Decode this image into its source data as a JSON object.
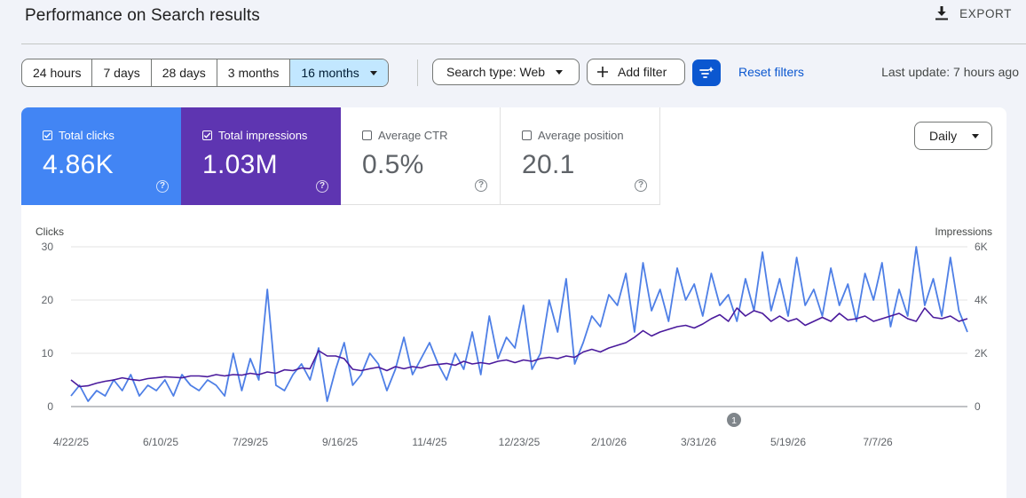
{
  "header": {
    "title": "Performance on Search results",
    "export_label": "EXPORT"
  },
  "filters": {
    "date_ranges": [
      "24 hours",
      "7 days",
      "28 days",
      "3 months",
      "16 months"
    ],
    "selected_range": "16 months",
    "search_type": "Search type: Web",
    "add_filter": "Add filter",
    "reset": "Reset filters",
    "last_update": "Last update: 7 hours ago"
  },
  "metrics": [
    {
      "label": "Total clicks",
      "value": "4.86K",
      "checked": true,
      "color": "#4285f4"
    },
    {
      "label": "Total impressions",
      "value": "1.03M",
      "checked": true,
      "color": "#5e35b1"
    },
    {
      "label": "Average CTR",
      "value": "0.5%",
      "checked": false
    },
    {
      "label": "Average position",
      "value": "20.1",
      "checked": false
    }
  ],
  "granularity": "Daily",
  "chart_data": {
    "type": "line",
    "x_tick_labels": [
      "4/22/25",
      "6/10/25",
      "7/29/25",
      "9/16/25",
      "11/4/25",
      "12/23/25",
      "2/10/26",
      "3/31/26",
      "5/19/26",
      "7/7/26"
    ],
    "y_left": {
      "label": "Clicks",
      "ticks": [
        0,
        10,
        20,
        30
      ],
      "range": [
        0,
        30
      ]
    },
    "y_right": {
      "label": "Impressions",
      "ticks": [
        "0",
        "2K",
        "4K",
        "6K"
      ],
      "range": [
        0,
        6000
      ]
    },
    "annotation": "1",
    "grid": true,
    "series": [
      {
        "name": "Clicks",
        "axis": "left",
        "color": "#4e7fe6",
        "sample_every_days": 4,
        "values": [
          2,
          4,
          1,
          3,
          2,
          5,
          3,
          6,
          2,
          4,
          3,
          5,
          2,
          6,
          4,
          3,
          5,
          4,
          2,
          10,
          3,
          9,
          5,
          22,
          4,
          3,
          6,
          8,
          5,
          11,
          1,
          7,
          12,
          4,
          6,
          10,
          8,
          3,
          7,
          13,
          6,
          9,
          12,
          8,
          5,
          10,
          7,
          14,
          6,
          17,
          9,
          13,
          11,
          19,
          7,
          10,
          20,
          14,
          24,
          8,
          12,
          17,
          15,
          21,
          19,
          25,
          14,
          27,
          18,
          22,
          16,
          26,
          20,
          23,
          17,
          25,
          19,
          21,
          16,
          24,
          18,
          29,
          18,
          24,
          17,
          28,
          19,
          22,
          17,
          26,
          19,
          23,
          16,
          25,
          20,
          27,
          15,
          22,
          17,
          30,
          19,
          24,
          17,
          28,
          18,
          14
        ]
      },
      {
        "name": "Impressions",
        "axis": "right",
        "color": "#4a1a9c",
        "sample_every_days": 4,
        "values": [
          1000,
          750,
          780,
          880,
          950,
          1000,
          1080,
          1020,
          980,
          1050,
          1080,
          1120,
          1100,
          1080,
          1150,
          1150,
          1120,
          1200,
          1150,
          1200,
          1180,
          1250,
          1200,
          1300,
          1250,
          1380,
          1350,
          1450,
          1420,
          2100,
          1900,
          1900,
          1800,
          1400,
          1350,
          1420,
          1480,
          1350,
          1500,
          1420,
          1500,
          1450,
          1550,
          1580,
          1620,
          1550,
          1700,
          1600,
          1650,
          1600,
          1700,
          1750,
          1650,
          1750,
          1700,
          1800,
          1850,
          1800,
          1900,
          1850,
          2050,
          2150,
          2050,
          2200,
          2300,
          2400,
          2600,
          2850,
          2650,
          2800,
          2900,
          3000,
          3050,
          2950,
          3100,
          3300,
          3450,
          3200,
          3700,
          3400,
          3600,
          3500,
          3200,
          3400,
          3200,
          3300,
          3050,
          3200,
          3350,
          3200,
          3500,
          3250,
          3300,
          3400,
          3200,
          3300,
          3400,
          3500,
          3300,
          3200,
          3700,
          3350,
          3300,
          3400,
          3200,
          3300
        ]
      }
    ]
  }
}
